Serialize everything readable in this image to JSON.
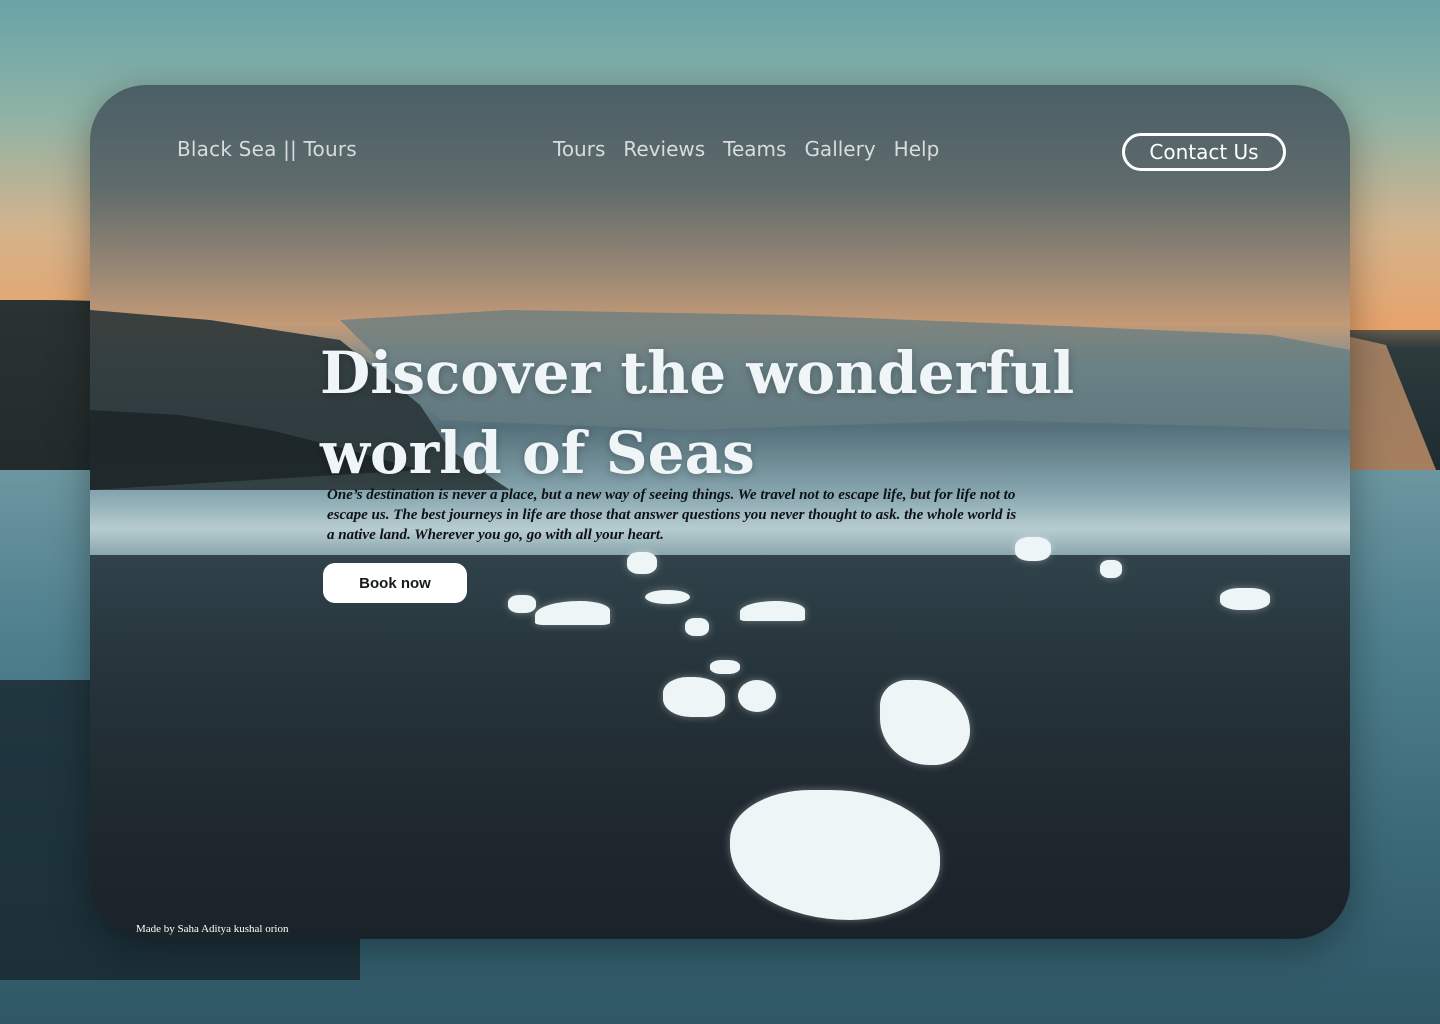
{
  "header": {
    "brand": "Black Sea || Tours",
    "nav": [
      "Tours",
      "Reviews",
      "Teams",
      "Gallery",
      "Help"
    ],
    "contact_label": "Contact Us"
  },
  "hero": {
    "title": "Discover the wonderful world of Seas",
    "description": "One’s destination is never a place, but a new way of seeing things. We travel not to escape life, but for life not to escape us. The best journeys in life are those that answer questions you never thought to ask. the whole world is a native land. Wherever you go, go with all your heart.",
    "cta_label": "Book now"
  },
  "footer": {
    "credit": "Made by Saha Aditya kushal orion"
  }
}
